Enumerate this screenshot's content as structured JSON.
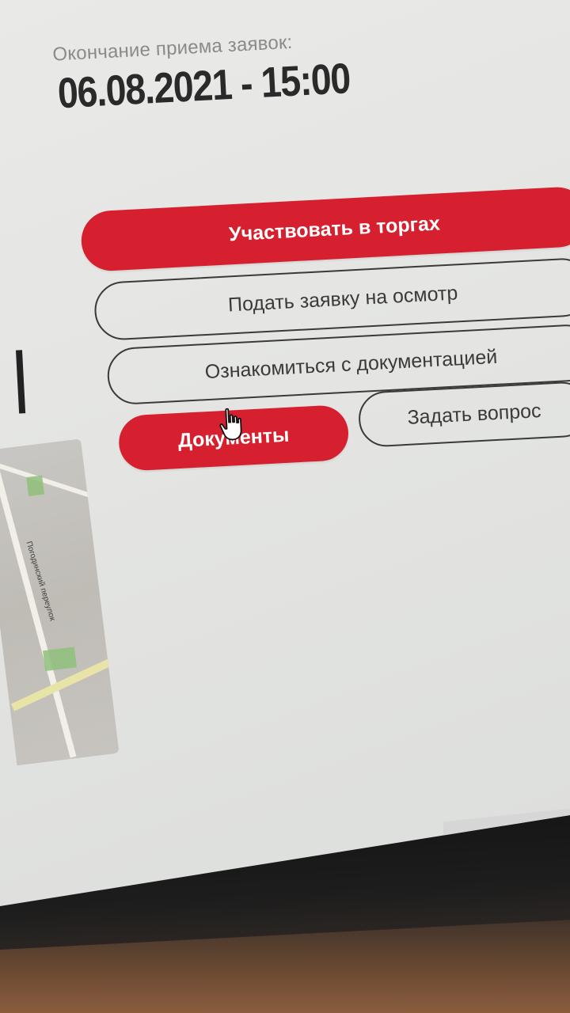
{
  "deadline": {
    "label": "Окончание приема заявок:",
    "value": "06.08.2021 - 15:00"
  },
  "actions": {
    "participate": "Участвовать в торгах",
    "inspection_request": "Подать заявку на осмотр",
    "review_docs": "Ознакомиться с документацией",
    "documents": "Документы",
    "ask_question": "Задать вопрос"
  },
  "map": {
    "street_label": "Погодинский переулок"
  },
  "colors": {
    "accent": "#d6202f",
    "text_dark": "#2a2a2a",
    "label_gray": "#8a8a8a",
    "page_bg": "#e6e7e5"
  },
  "icons": {
    "cursor": "hand-pointer-icon",
    "taskbar": "chrome-icon"
  }
}
